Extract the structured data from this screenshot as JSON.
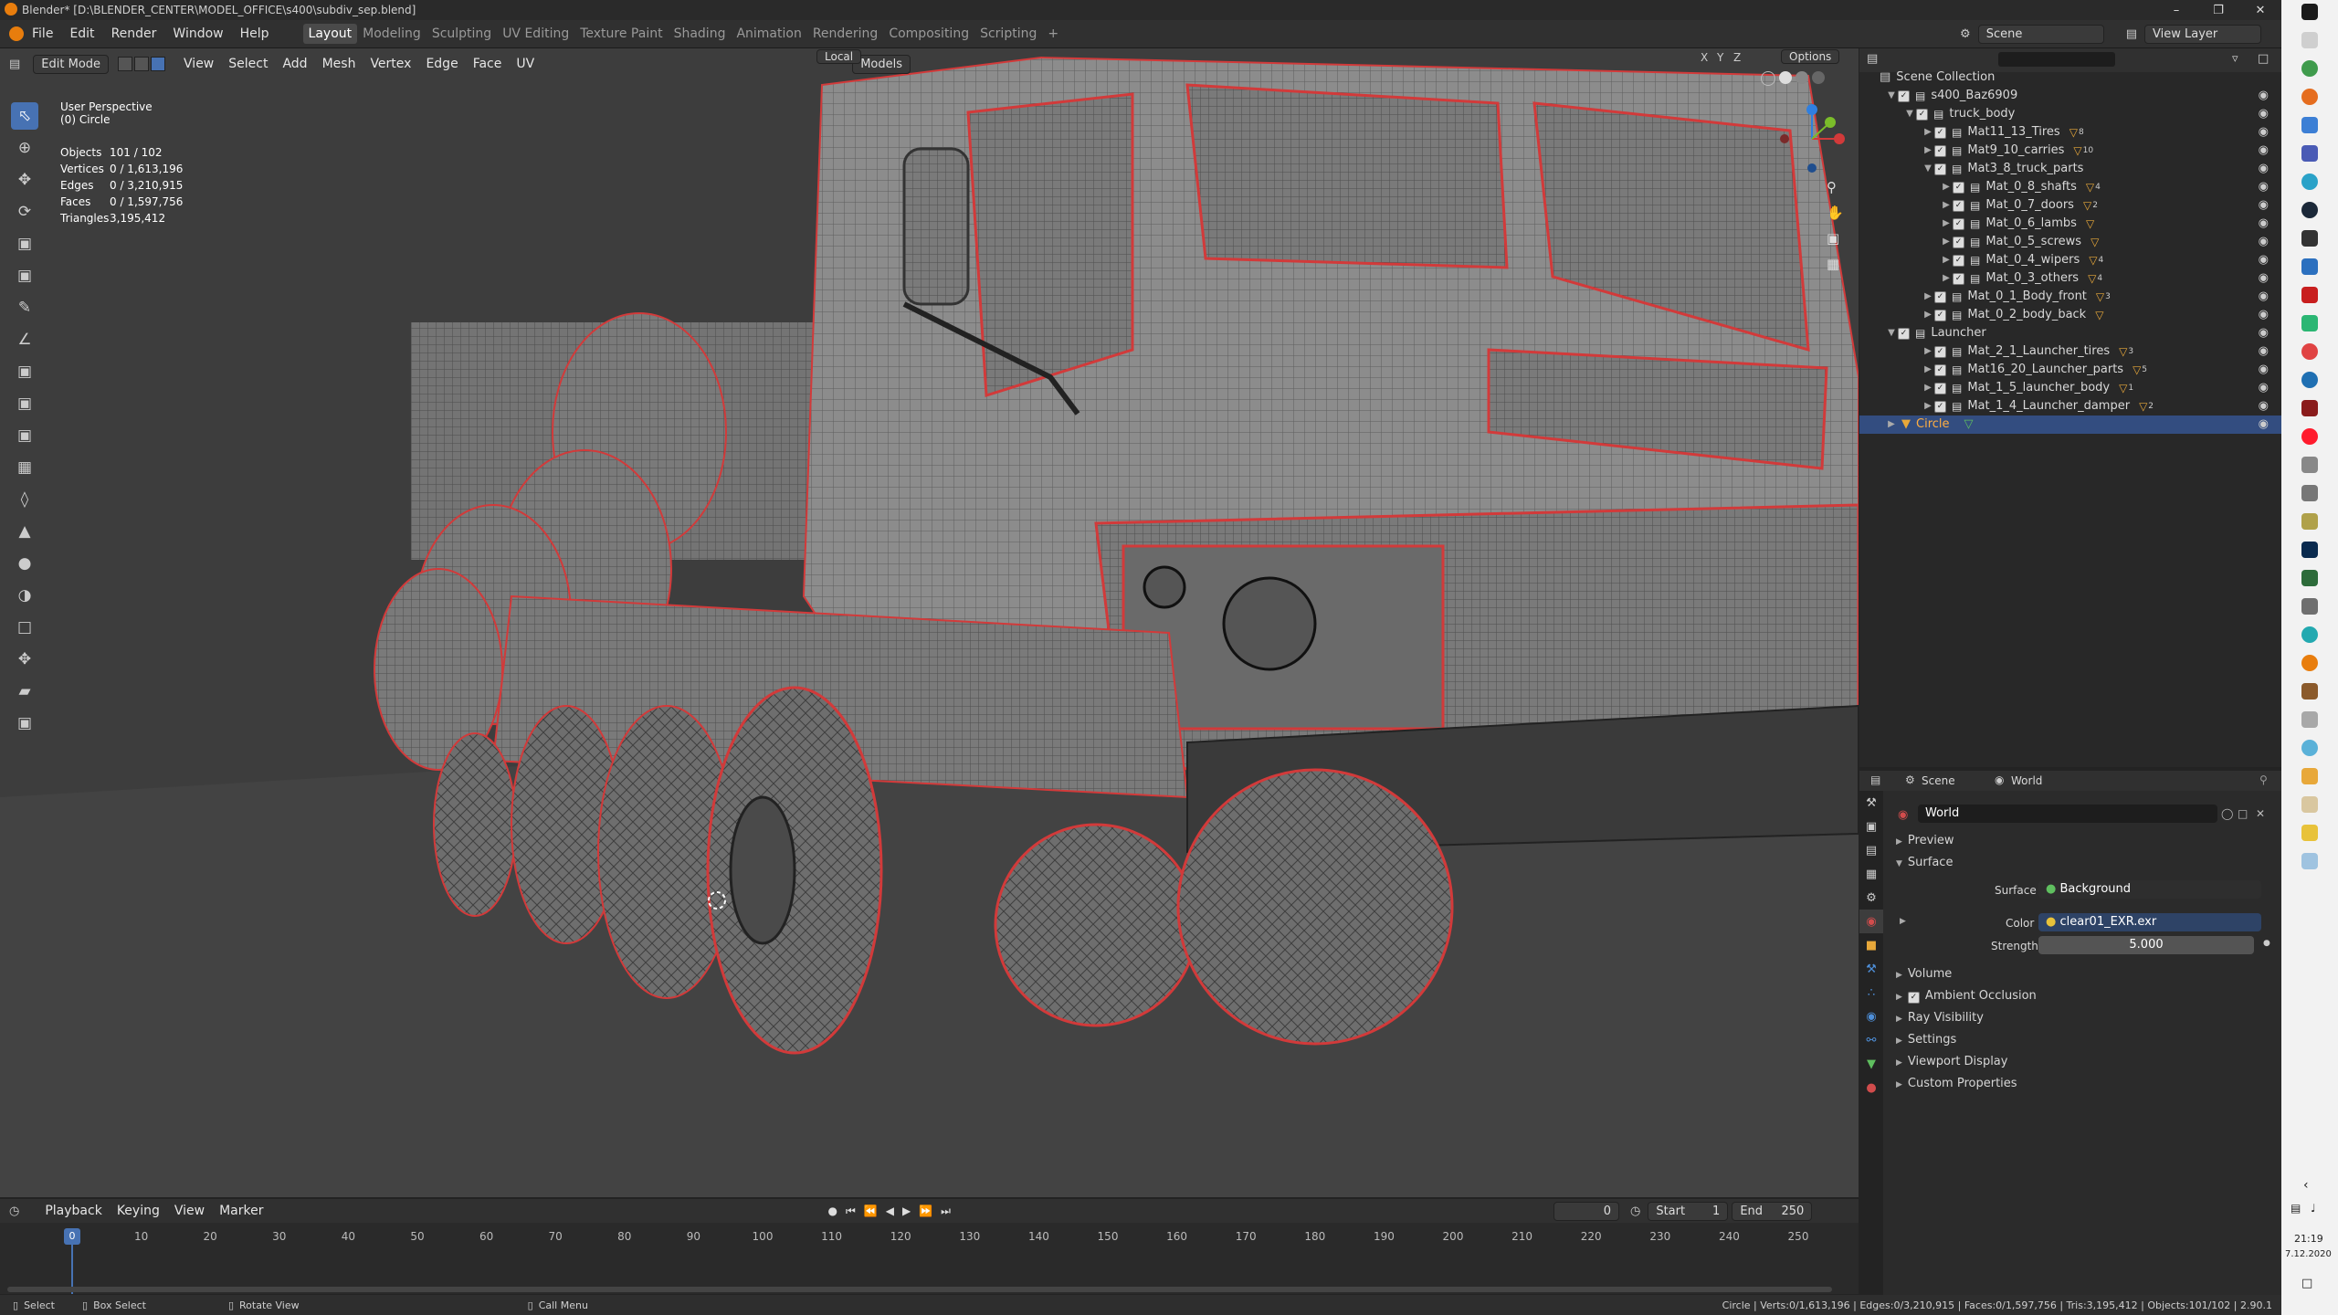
{
  "window": {
    "title": "Blender* [D:\\BLENDER_CENTER\\MODEL_OFFICE\\s400\\subdiv_sep.blend]",
    "minimize": "–",
    "maximize": "❐",
    "close": "✕"
  },
  "menus": [
    "File",
    "Edit",
    "Render",
    "Window",
    "Help"
  ],
  "workspaces": [
    "Layout",
    "Modeling",
    "Sculpting",
    "UV Editing",
    "Texture Paint",
    "Shading",
    "Animation",
    "Rendering",
    "Compositing",
    "Scripting",
    "+"
  ],
  "scene_label": "Scene",
  "view_layer_label": "View Layer",
  "viewport_header": {
    "mode": "Edit Mode",
    "menus": [
      "View",
      "Select",
      "Add",
      "Mesh",
      "Vertex",
      "Edge",
      "Face",
      "UV"
    ],
    "transform": "Local",
    "snap_target": "Models",
    "options": "Options",
    "axes": [
      "X",
      "Y",
      "Z"
    ]
  },
  "viewport_info": {
    "perspective": "User Perspective",
    "object": "(0) Circle",
    "stats": [
      {
        "k": "Objects",
        "v": "101 / 102"
      },
      {
        "k": "Vertices",
        "v": "0 / 1,613,196"
      },
      {
        "k": "Edges",
        "v": "0 / 3,210,915"
      },
      {
        "k": "Faces",
        "v": "0 / 1,597,756"
      },
      {
        "k": "Triangles",
        "v": "3,195,412"
      }
    ]
  },
  "outliner": {
    "root": "Scene Collection",
    "rows": [
      {
        "label": "s400_Baz6909",
        "depth": 1,
        "type": "collection",
        "expanded": true
      },
      {
        "label": "truck_body",
        "depth": 2,
        "type": "collection",
        "expanded": true
      },
      {
        "label": "Mat11_13_Tires",
        "depth": 3,
        "type": "collection",
        "badge": "8"
      },
      {
        "label": "Mat9_10_carries",
        "depth": 3,
        "type": "collection",
        "badge": "10"
      },
      {
        "label": "Mat3_8_truck_parts",
        "depth": 3,
        "type": "collection",
        "expanded": true
      },
      {
        "label": "Mat_0_8_shafts",
        "depth": 4,
        "type": "collection",
        "badge": "4"
      },
      {
        "label": "Mat_0_7_doors",
        "depth": 4,
        "type": "collection",
        "badge": "2"
      },
      {
        "label": "Mat_0_6_lambs",
        "depth": 4,
        "type": "collection",
        "badge": ""
      },
      {
        "label": "Mat_0_5_screws",
        "depth": 4,
        "type": "collection",
        "badge": ""
      },
      {
        "label": "Mat_0_4_wipers",
        "depth": 4,
        "type": "collection",
        "badge": "4"
      },
      {
        "label": "Mat_0_3_others",
        "depth": 4,
        "type": "collection",
        "badge": "4"
      },
      {
        "label": "Mat_0_1_Body_front",
        "depth": 3,
        "type": "collection",
        "badge": "3"
      },
      {
        "label": "Mat_0_2_body_back",
        "depth": 3,
        "type": "collection",
        "badge": ""
      },
      {
        "label": "Launcher",
        "depth": 1,
        "type": "collection",
        "expanded": true
      },
      {
        "label": "Mat_2_1_Launcher_tires",
        "depth": 3,
        "type": "collection",
        "badge": "3"
      },
      {
        "label": "Mat16_20_Launcher_parts",
        "depth": 3,
        "type": "collection",
        "badge": "5"
      },
      {
        "label": "Mat_1_5_launcher_body",
        "depth": 3,
        "type": "collection",
        "badge": "1"
      },
      {
        "label": "Mat_1_4_Launcher_damper",
        "depth": 3,
        "type": "collection",
        "badge": "2"
      },
      {
        "label": "Circle",
        "depth": 1,
        "type": "object",
        "selected": true
      }
    ]
  },
  "properties": {
    "breadcrumb": [
      "Scene",
      "World"
    ],
    "world_name": "World",
    "panels": {
      "preview": "Preview",
      "surface": "Surface",
      "surface_label": "Surface",
      "surface_value": "Background",
      "color_label": "Color",
      "color_value": "clear01_EXR.exr",
      "strength_label": "Strength",
      "strength_value": "5.000",
      "volume": "Volume",
      "ambient_occlusion": "Ambient Occlusion",
      "ray_visibility": "Ray Visibility",
      "settings": "Settings",
      "viewport_display": "Viewport Display",
      "custom_properties": "Custom Properties"
    }
  },
  "timeline": {
    "menus": [
      "Playback",
      "Keying",
      "View",
      "Marker"
    ],
    "current_frame": "0",
    "start_label": "Start",
    "start": "1",
    "end_label": "End",
    "end": "250",
    "ticks": [
      "0",
      "10",
      "20",
      "30",
      "40",
      "50",
      "60",
      "70",
      "80",
      "90",
      "100",
      "110",
      "120",
      "130",
      "140",
      "150",
      "160",
      "170",
      "180",
      "190",
      "200",
      "210",
      "220",
      "230",
      "240",
      "250"
    ]
  },
  "statusbar": {
    "select": "Select",
    "box_select": "Box Select",
    "rotate_view": "Rotate View",
    "call_menu": "Call Menu",
    "info": "Circle | Verts:0/1,613,196 | Edges:0/3,210,915 | Faces:0/1,597,756 | Tris:3,195,412 | Objects:101/102 | 2.90.1"
  },
  "taskbar": {
    "time": "21:19",
    "date": "7.12.2020"
  },
  "colors": {
    "accent": "#4772b3",
    "selection": "#334d80",
    "seam_red": "#d23a3a",
    "viewport_bg": "#3d3d3d"
  }
}
